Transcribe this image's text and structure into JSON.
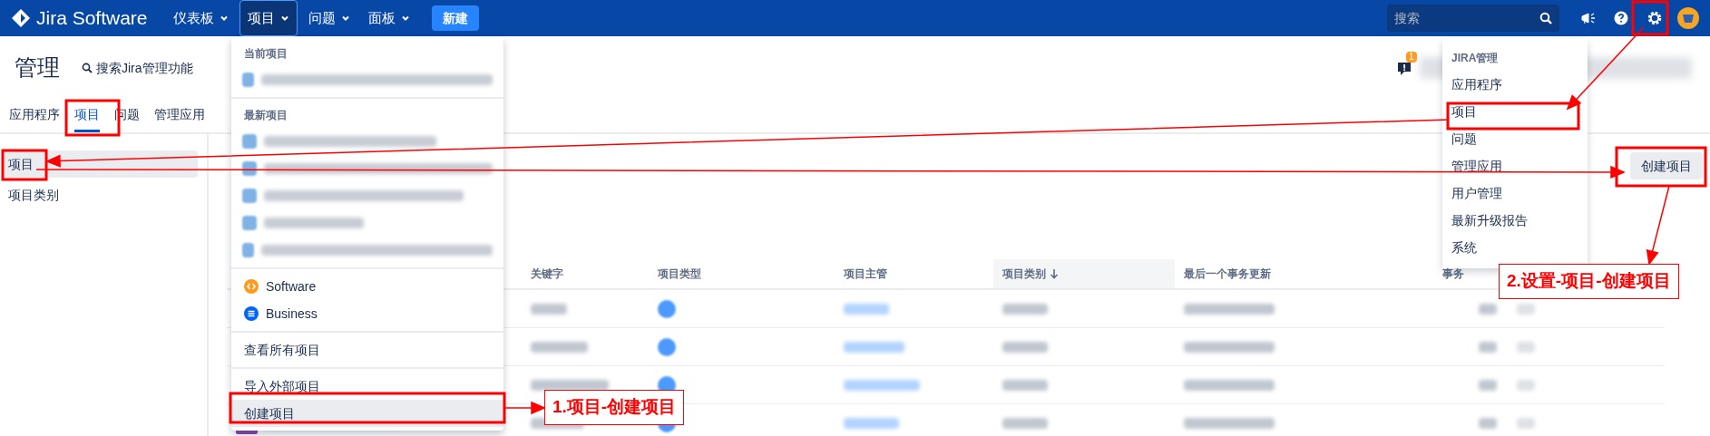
{
  "nav": {
    "logo": "Jira Software",
    "items": [
      {
        "label": "仪表板",
        "selected": false
      },
      {
        "label": "项目",
        "selected": true
      },
      {
        "label": "问题",
        "selected": false
      },
      {
        "label": "面板",
        "selected": false
      }
    ],
    "create_button": "新建",
    "search": {
      "placeholder": "搜索"
    }
  },
  "admin": {
    "title": "管理",
    "search_link": "搜索Jira管理功能",
    "notification_count": "1",
    "tabs": [
      {
        "label": "应用程序",
        "selected": false
      },
      {
        "label": "项目",
        "selected": true
      },
      {
        "label": "问题",
        "selected": false
      },
      {
        "label": "管理应用",
        "selected": false
      }
    ],
    "sidebar": [
      {
        "label": "项目",
        "selected": true
      },
      {
        "label": "项目类别",
        "selected": false
      }
    ],
    "create_project_button": "创建项目"
  },
  "table": {
    "columns": [
      {
        "label": "关键字",
        "sorted": false
      },
      {
        "label": "项目类型",
        "sorted": false
      },
      {
        "label": "项目主管",
        "sorted": false
      },
      {
        "label": "项目类别",
        "sorted": true
      },
      {
        "label": "最后一个事务更新",
        "sorted": false
      },
      {
        "label": "事务",
        "sorted": false
      }
    ],
    "rows": [
      {
        "kind": "redacted"
      },
      {
        "kind": "redacted"
      },
      {
        "kind": "redacted"
      },
      {
        "kind": "redacted"
      }
    ]
  },
  "project_menu": {
    "sections": [
      {
        "heading": "当前项目",
        "items": [
          {
            "kind": "redacted"
          }
        ]
      },
      {
        "heading": "最新项目",
        "items": [
          {
            "kind": "redacted"
          },
          {
            "kind": "redacted"
          },
          {
            "kind": "redacted"
          },
          {
            "kind": "redacted"
          },
          {
            "kind": "redacted"
          }
        ]
      },
      {
        "items": [
          {
            "kind": "software",
            "label": "Software"
          },
          {
            "kind": "business",
            "label": "Business"
          }
        ]
      },
      {
        "items": [
          {
            "kind": "link",
            "label": "查看所有项目",
            "highlighted": false
          }
        ]
      },
      {
        "items": [
          {
            "kind": "link",
            "label": "导入外部项目",
            "highlighted": false
          },
          {
            "kind": "link",
            "label": "创建项目",
            "highlighted": true
          }
        ]
      }
    ]
  },
  "admin_menu": {
    "heading": "JIRA管理",
    "items": [
      "应用程序",
      "项目",
      "问题",
      "管理应用",
      "用户管理",
      "最新升级报告",
      "系统"
    ]
  },
  "annotations": [
    {
      "text": "1.项目-创建项目"
    },
    {
      "text": "2.设置-项目-创建项目"
    }
  ]
}
